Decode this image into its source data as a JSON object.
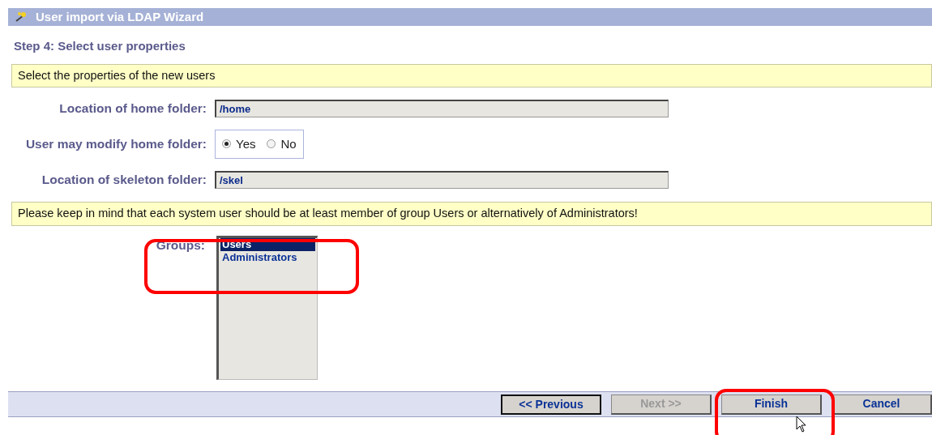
{
  "window": {
    "title": "User import via LDAP Wizard"
  },
  "step_heading": "Step 4: Select user properties",
  "intro_note": "Select the properties of the new users",
  "fields": [
    {
      "kind": "text",
      "label": "Location of home folder:",
      "value": "/home"
    },
    {
      "kind": "radio",
      "label": "User may modify home folder:",
      "options": [
        {
          "label": "Yes",
          "selected": true
        },
        {
          "label": "No",
          "selected": false
        }
      ]
    },
    {
      "kind": "text",
      "label": "Location of skeleton folder:",
      "value": "/skel"
    }
  ],
  "warning_note": "Please keep in mind that each system user should be at least member of group Users or alternatively of Administrators!",
  "groups": {
    "label": "Groups:",
    "items": [
      {
        "label": "Users",
        "selected": true
      },
      {
        "label": "Administrators",
        "selected": false
      }
    ]
  },
  "buttons": [
    {
      "label": "<< Previous",
      "disabled": false,
      "focused": true
    },
    {
      "label": "Next >>",
      "disabled": true,
      "focused": false
    },
    {
      "label": "Finish",
      "disabled": false,
      "focused": false
    },
    {
      "label": "Cancel",
      "disabled": false,
      "focused": false
    }
  ]
}
